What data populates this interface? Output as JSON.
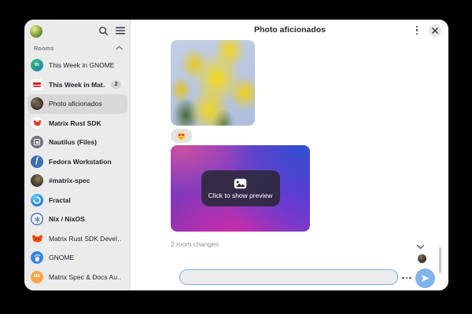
{
  "colors": {
    "accent": "#3584e4",
    "send_button": "#80b2ec",
    "sidebar_bg": "#ebebeb",
    "selected_row_bg": "#d8d8d8",
    "unread_badge_bg": "#d2d2d2",
    "overlay_button_bg": "#2e293e"
  },
  "header": {
    "title": "Photo aficionados"
  },
  "sidebar": {
    "section_label": "Rooms",
    "items": [
      {
        "id": "this-week-in-gnome",
        "label": "This Week in GNOME",
        "icon": "twig-icon",
        "icon_text": "th",
        "unread": false,
        "selected": false
      },
      {
        "id": "this-week-in-matrix",
        "label": "This Week in Mat…",
        "icon": "twim-icon",
        "unread": true,
        "selected": false,
        "badge": "2"
      },
      {
        "id": "photo-aficionados",
        "label": "Photo aficionados",
        "icon": "photo-avatar",
        "unread": false,
        "selected": true
      },
      {
        "id": "matrix-rust-sdk",
        "label": "Matrix Rust SDK",
        "icon": "rust-crab-icon",
        "unread": true,
        "selected": false
      },
      {
        "id": "nautilus-files",
        "label": "Nautilus (Files)",
        "icon": "nautilus-icon",
        "unread": true,
        "selected": false
      },
      {
        "id": "fedora-workstation",
        "label": "Fedora Workstation",
        "icon": "fedora-icon",
        "icon_text": "f",
        "unread": true,
        "selected": false
      },
      {
        "id": "matrix-spec",
        "label": "#matrix-spec",
        "icon": "matrix-spec-avatar",
        "unread": true,
        "selected": false
      },
      {
        "id": "fractal",
        "label": "Fractal",
        "icon": "fractal-icon",
        "unread": true,
        "selected": false
      },
      {
        "id": "nix-nixos",
        "label": "Nix / NixOS",
        "icon": "nix-icon",
        "unread": true,
        "selected": false
      },
      {
        "id": "matrix-rust-sdk-developers",
        "label": "Matrix Rust SDK Devel…",
        "icon": "ferris-icon",
        "unread": false,
        "selected": false
      },
      {
        "id": "gnome",
        "label": "GNOME",
        "icon": "gnome-icon",
        "unread": false,
        "selected": false
      },
      {
        "id": "matrix-spec-docs",
        "label": "Matrix Spec & Docs Au…",
        "icon": "ma-avatar-icon",
        "icon_text": "MA",
        "unread": false,
        "selected": false
      }
    ]
  },
  "timeline": {
    "reaction_emoji": "heart-eyes",
    "preview_button_label": "Click to show preview",
    "room_changes_label": "2 room changes"
  },
  "composer": {
    "value": ""
  }
}
